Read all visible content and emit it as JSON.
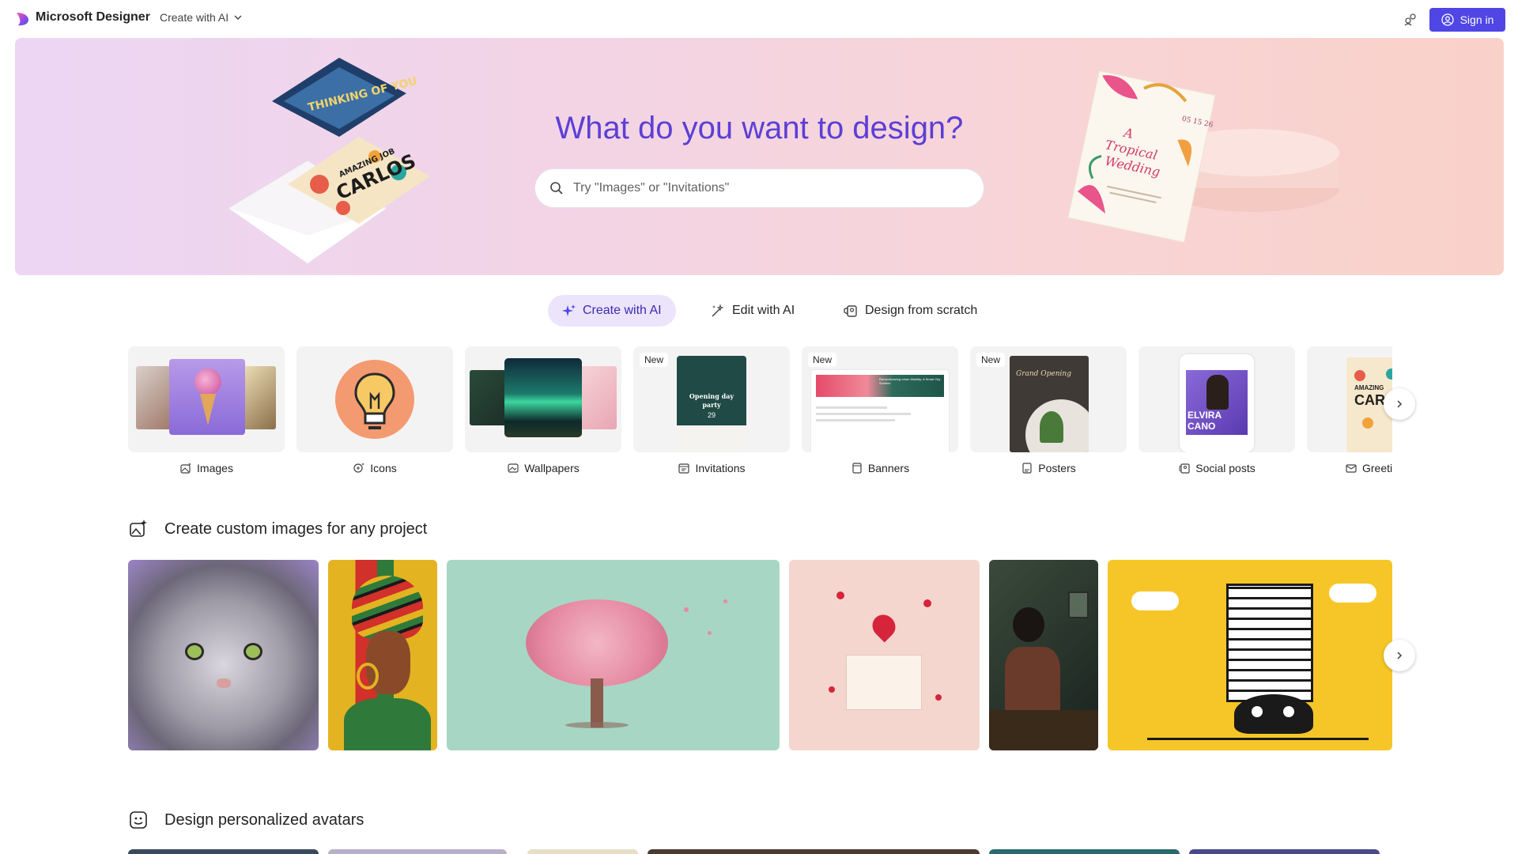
{
  "header": {
    "brand": "Microsoft Designer",
    "create_menu": "Create with AI",
    "signin": "Sign in"
  },
  "hero": {
    "title": "What do you want to design?",
    "search_placeholder": "Try \"Images\" or \"Invitations\"",
    "card_left_top": "THINKING OF YOU",
    "card_left_mid": "CARLOS",
    "card_left_small": "AMAZING JOB",
    "card_right_title_1": "A",
    "card_right_title_2": "Tropical",
    "card_right_title_3": "Wedding",
    "card_right_date": "05 15 26"
  },
  "tabs": [
    {
      "label": "Create with AI"
    },
    {
      "label": "Edit with AI"
    },
    {
      "label": "Design from scratch"
    }
  ],
  "categories": [
    {
      "label": "Images",
      "icon": "image-ai-icon"
    },
    {
      "label": "Icons",
      "icon": "icons-icon"
    },
    {
      "label": "Wallpapers",
      "icon": "wallpaper-icon"
    },
    {
      "label": "Invitations",
      "icon": "invitation-icon",
      "badge": "New",
      "thumb_text_1": "Opening day",
      "thumb_text_2": "party",
      "thumb_text_3": "29"
    },
    {
      "label": "Banners",
      "icon": "banner-icon",
      "badge": "New",
      "thumb_text_1": "Revolutionizing urban Mobility: A Smart City Solution"
    },
    {
      "label": "Posters",
      "icon": "poster-icon",
      "badge": "New",
      "thumb_text_1": "Grand Opening"
    },
    {
      "label": "Social posts",
      "icon": "social-post-icon",
      "thumb_text_1": "ELVIRA",
      "thumb_text_2": "CANO"
    },
    {
      "label": "Greetin",
      "icon": "greeting-card-icon",
      "thumb_text_1": "AMAZING",
      "thumb_text_2": "CAR"
    }
  ],
  "sections": {
    "custom_images": "Create custom images for any project",
    "avatars": "Design personalized avatars"
  },
  "colors": {
    "accent": "#4f46e5",
    "title": "#5b3fd6",
    "tab_active_bg": "#ebe4fb"
  }
}
